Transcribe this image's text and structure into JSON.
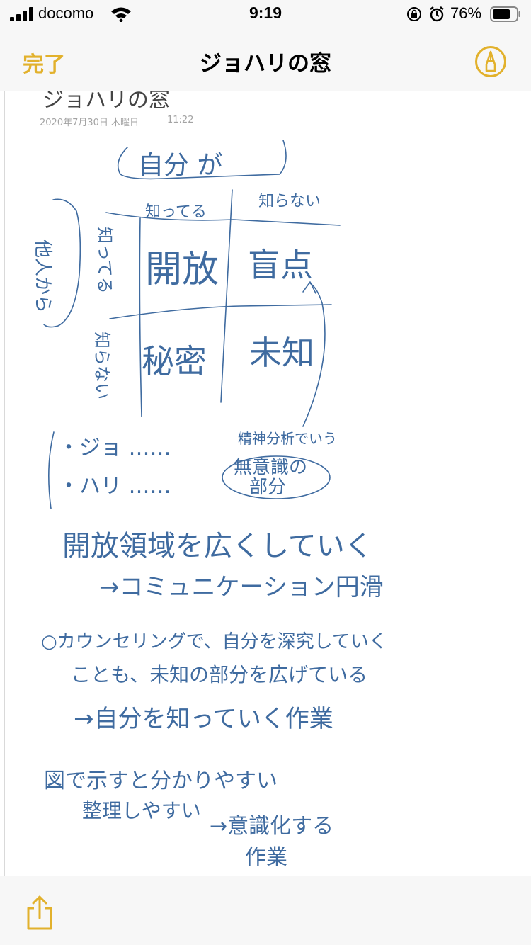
{
  "status": {
    "carrier": "docomo",
    "time": "9:19",
    "battery_percent": "76%",
    "battery_level": 0.76
  },
  "nav": {
    "done_label": "完了",
    "title": "ジョハリの窓"
  },
  "note": {
    "title": "ジョハリの窓",
    "date": "2020年7月30日 木曜日",
    "time": "11:22",
    "handwriting": {
      "header": "自分 が",
      "col_known": "知ってる",
      "col_unknown": "知らない",
      "row_known": "知ってる",
      "row_unknown": "知らない",
      "side": "他人から",
      "cell_open": "開放",
      "cell_blind": "盲点",
      "cell_hidden": "秘密",
      "cell_unknown": "未知",
      "jo": "・ジョ ……",
      "hari": "・ハリ ……",
      "note_area_1": "精神分析でいう",
      "note_area_2": "無意識の",
      "note_area_3": "部分",
      "line1": "開放領域を広くしていく",
      "line2": "→コミュニケーション円滑",
      "line3": "○カウンセリングで、自分を深究していく",
      "line4": "ことも、未知の部分を広げている",
      "line5": "→自分を知っていく作業",
      "line6": "図で示すと分かりやすい",
      "line7": "整理しやすい",
      "line8": "→意識化する",
      "line9": "作業"
    }
  },
  "icons": {
    "accent": "#e2b12c",
    "ink": "#3f6ba0",
    "markup": "pen-circle-icon",
    "share": "share-icon"
  }
}
